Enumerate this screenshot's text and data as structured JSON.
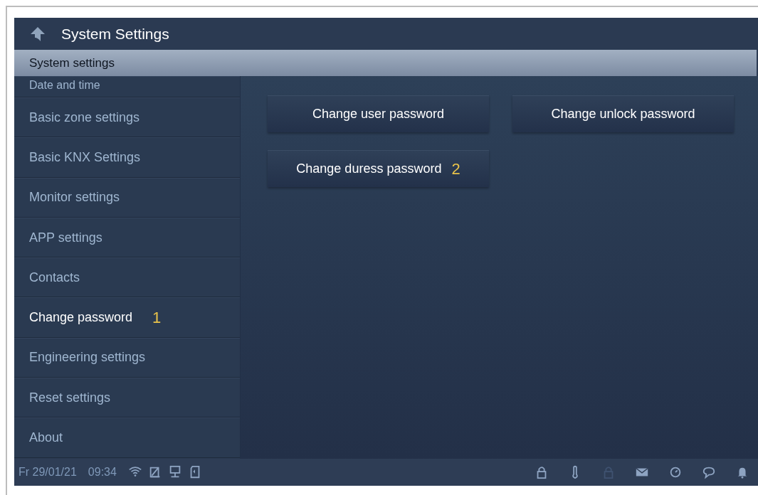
{
  "header": {
    "title": "System Settings"
  },
  "subheader": {
    "title": "System settings"
  },
  "sidebar": {
    "items": [
      {
        "label": "Date and time",
        "selected": false
      },
      {
        "label": "Basic zone settings",
        "selected": false
      },
      {
        "label": "Basic KNX Settings",
        "selected": false
      },
      {
        "label": "Monitor settings",
        "selected": false
      },
      {
        "label": "APP settings",
        "selected": false
      },
      {
        "label": "Contacts",
        "selected": false
      },
      {
        "label": "Change password",
        "selected": true,
        "annotation": "1"
      },
      {
        "label": "Engineering settings",
        "selected": false
      },
      {
        "label": "Reset settings",
        "selected": false
      },
      {
        "label": "About",
        "selected": false
      }
    ]
  },
  "buttons": [
    {
      "label": "Change user password"
    },
    {
      "label": "Change unlock password"
    },
    {
      "label": "Change duress password",
      "annotation": "2"
    }
  ],
  "status_bar": {
    "date": "Fr 29/01/21",
    "time": "09:34",
    "left_icons": [
      {
        "kind": "wifi",
        "dimmed": false
      },
      {
        "kind": "note",
        "dimmed": false
      },
      {
        "kind": "network",
        "dimmed": false
      },
      {
        "kind": "card",
        "dimmed": false
      }
    ],
    "right_icons": [
      {
        "kind": "lock",
        "dimmed": false
      },
      {
        "kind": "thermometer",
        "dimmed": false
      },
      {
        "kind": "lock",
        "dimmed": true
      },
      {
        "kind": "envelope",
        "dimmed": false
      },
      {
        "kind": "clock",
        "dimmed": false
      },
      {
        "kind": "chat",
        "dimmed": false
      },
      {
        "kind": "bell",
        "dimmed": false
      }
    ]
  }
}
